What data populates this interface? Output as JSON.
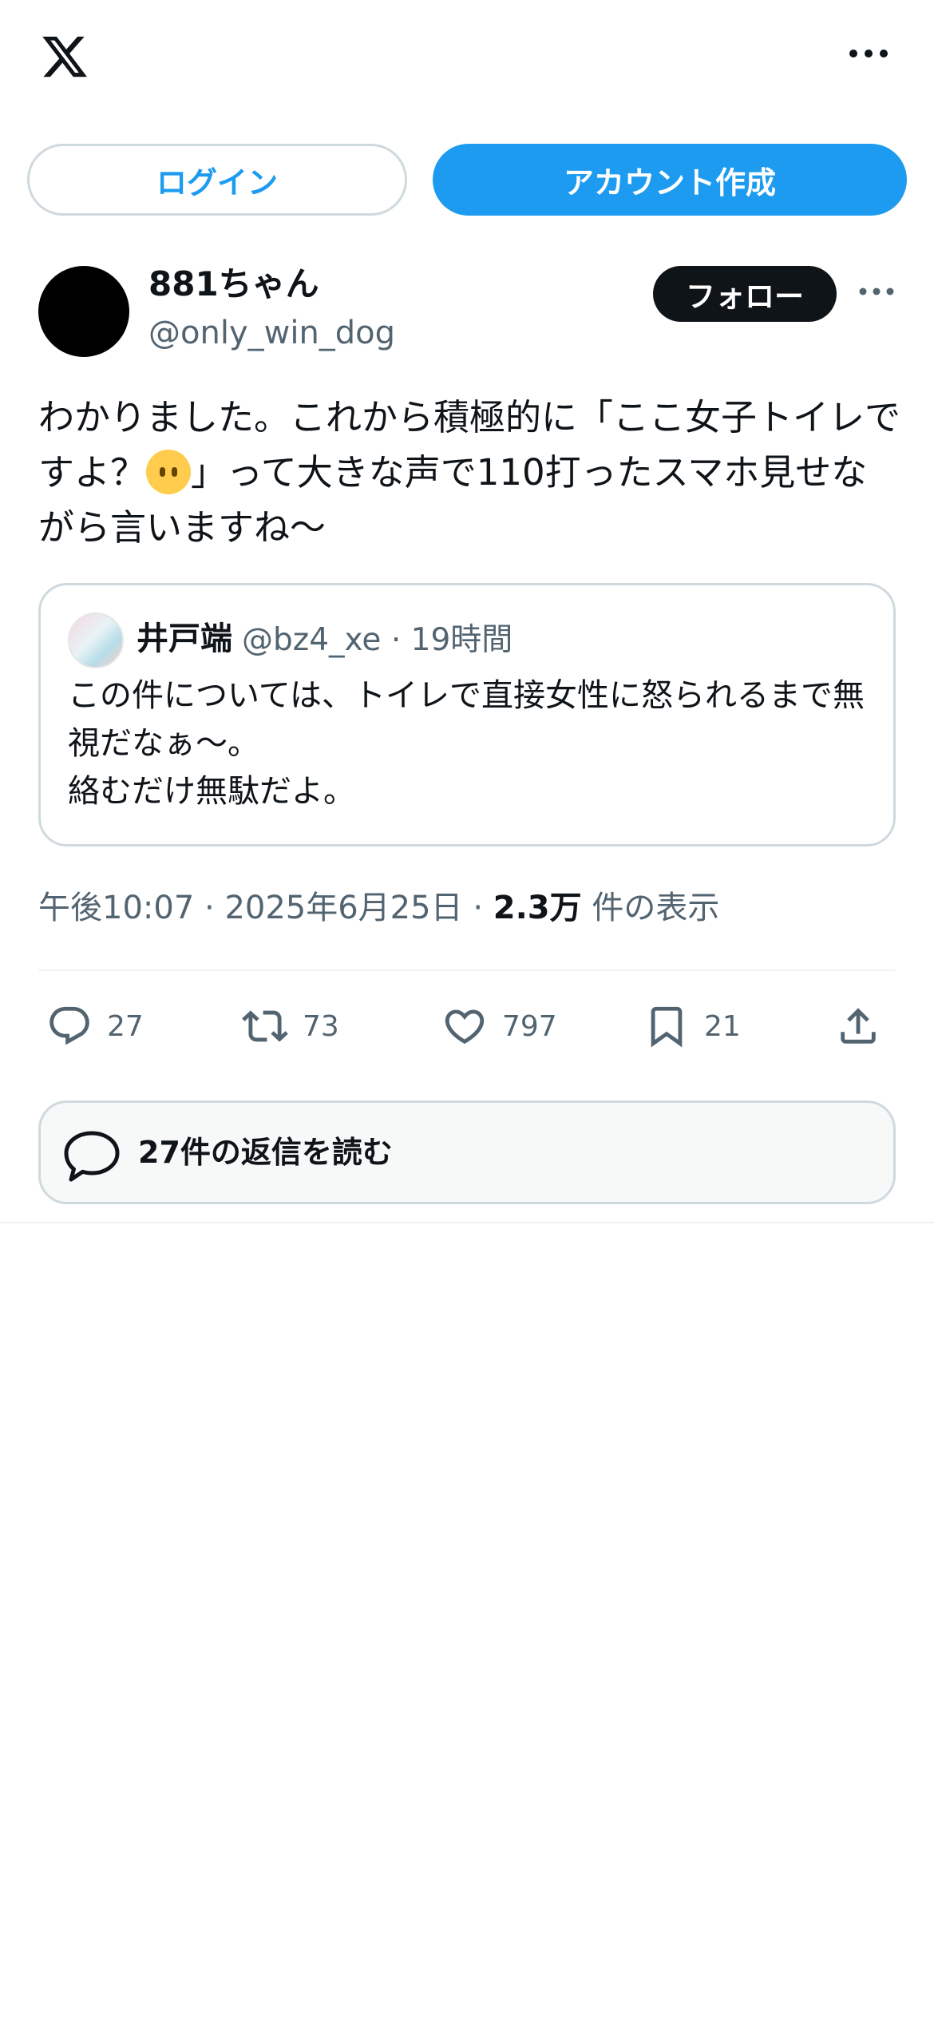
{
  "header": {
    "logo_icon": "x-logo-icon",
    "more_icon": "more-horizontal-icon"
  },
  "auth": {
    "login_label": "ログイン",
    "signup_label": "アカウント作成"
  },
  "post": {
    "display_name": "881ちゃん",
    "handle": "@only_win_dog",
    "follow_label": "フォロー",
    "text_before_emoji": "わかりました。これから積極的に「ここ女子トイレですよ？",
    "emoji": "face-without-mouth-emoji",
    "text_after_emoji": "」って大きな声で110打ったスマホ見せながら言いますね〜",
    "quote": {
      "display_name": "井戸端",
      "handle": "@bz4_xe",
      "separator": "·",
      "time": "19時間",
      "text": "この件については、トイレで直接女性に怒られるまで無視だなぁ〜。\n絡むだけ無駄だよ。"
    },
    "timestamp": "午後10:07",
    "separator": "·",
    "date": "2025年6月25日",
    "views_count": "2.3万",
    "views_label": "件の表示",
    "stats": {
      "replies": "27",
      "reposts": "73",
      "likes": "797",
      "bookmarks": "21"
    },
    "read_replies_label": "27件の返信を読む"
  },
  "colors": {
    "accent": "#1d9bf0",
    "text_primary": "#0f1419",
    "text_secondary": "#536471",
    "border": "#cfd9de"
  }
}
